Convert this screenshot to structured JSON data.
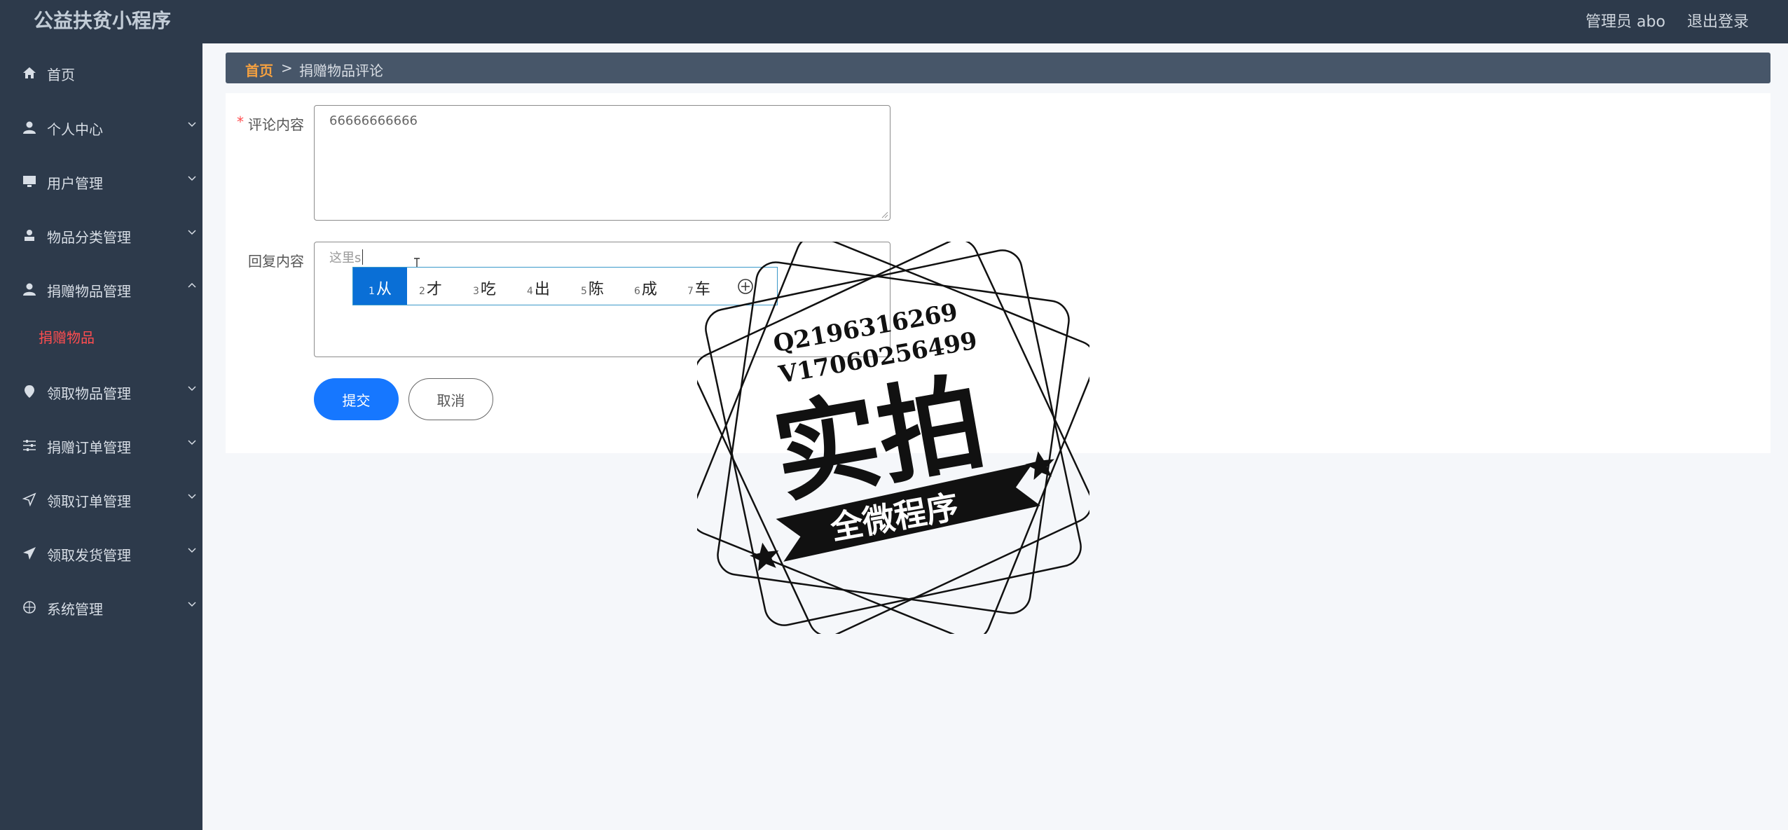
{
  "header": {
    "app_title": "公益扶贫小程序",
    "user_label": "管理员 abo",
    "logout_label": "退出登录"
  },
  "sidebar": {
    "items": [
      {
        "label": "首页",
        "icon": "home-icon"
      },
      {
        "label": "个人中心",
        "icon": "user-icon",
        "chevron": "down"
      },
      {
        "label": "用户管理",
        "icon": "monitor-icon",
        "chevron": "down"
      },
      {
        "label": "物品分类管理",
        "icon": "person-stamp-icon",
        "chevron": "down"
      },
      {
        "label": "捐赠物品管理",
        "icon": "user-icon",
        "chevron": "up"
      },
      {
        "label": "领取物品管理",
        "icon": "location-icon",
        "chevron": "down"
      },
      {
        "label": "捐赠订单管理",
        "icon": "sliders-icon",
        "chevron": "down"
      },
      {
        "label": "领取订单管理",
        "icon": "send-icon",
        "chevron": "down"
      },
      {
        "label": "领取发货管理",
        "icon": "paper-plane-icon",
        "chevron": "down"
      },
      {
        "label": "系统管理",
        "icon": "compass-icon",
        "chevron": "down"
      }
    ],
    "active_submenu": "捐赠物品"
  },
  "breadcrumb": {
    "home": "首页",
    "separator": ">",
    "current": "捐赠物品评论"
  },
  "form": {
    "comment_label": "评论内容",
    "comment_value": "66666666666",
    "reply_label": "回复内容",
    "reply_placeholder": "这里s",
    "submit_label": "提交",
    "cancel_label": "取消"
  },
  "ime": {
    "candidates": [
      {
        "num": "1",
        "text": "从"
      },
      {
        "num": "2",
        "text": "才"
      },
      {
        "num": "3",
        "text": "吃"
      },
      {
        "num": "4",
        "text": "出"
      },
      {
        "num": "5",
        "text": "陈"
      },
      {
        "num": "6",
        "text": "成"
      },
      {
        "num": "7",
        "text": "车"
      }
    ],
    "selected_index": 0
  },
  "watermark": {
    "line1": "Q2196316269",
    "line2": "V17060256499",
    "big_text": "实拍",
    "banner_text": "全微程序"
  },
  "colors": {
    "sidebar_bg": "#2d3a4b",
    "accent": "#1677ff",
    "breadcrumb_home": "#f4a040",
    "required": "#ff4d4f"
  }
}
